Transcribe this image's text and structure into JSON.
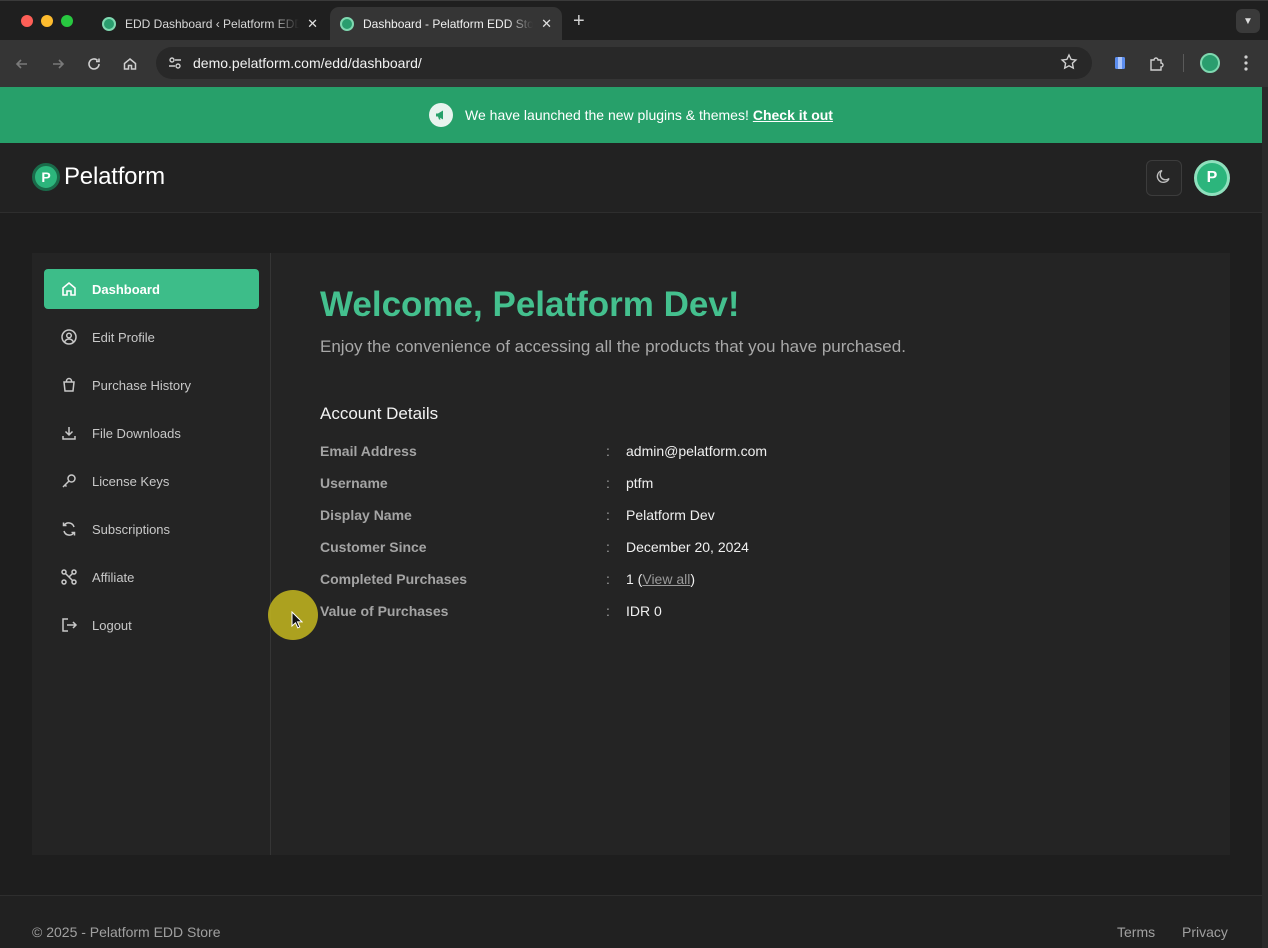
{
  "browser": {
    "tabs": [
      {
        "title": "EDD Dashboard ‹ Pelatform EDD Store",
        "active": false
      },
      {
        "title": "Dashboard - Pelatform EDD Store",
        "active": true
      }
    ],
    "url": "demo.pelatform.com/edd/dashboard/",
    "icons": {
      "back": "arrow-left-icon",
      "forward": "arrow-right-icon",
      "reload": "reload-icon",
      "home": "home-icon",
      "site_info": "tune-icon",
      "bookmark": "star-icon",
      "extension_1": "bookmark-extension-icon",
      "extensions": "puzzle-icon",
      "profile": "profile-icon",
      "menu": "kebab-menu-icon",
      "new_tab": "plus-icon",
      "tab_close": "close-icon",
      "tab_search": "chevron-down-icon"
    }
  },
  "announcement": {
    "text": "We have launched the new plugins & themes!",
    "link": "Check it out",
    "icon": "megaphone-icon"
  },
  "header": {
    "logo_text": "Pelatform",
    "theme_toggle_icon": "moon-icon"
  },
  "sidebar": {
    "items": [
      {
        "label": "Dashboard",
        "icon": "home-icon",
        "active": true
      },
      {
        "label": "Edit Profile",
        "icon": "user-circle-icon",
        "active": false
      },
      {
        "label": "Purchase History",
        "icon": "shopping-bag-icon",
        "active": false
      },
      {
        "label": "File Downloads",
        "icon": "download-icon",
        "active": false
      },
      {
        "label": "License Keys",
        "icon": "key-icon",
        "active": false
      },
      {
        "label": "Subscriptions",
        "icon": "refresh-icon",
        "active": false
      },
      {
        "label": "Affiliate",
        "icon": "share-nodes-icon",
        "active": false
      },
      {
        "label": "Logout",
        "icon": "logout-icon",
        "active": false
      }
    ]
  },
  "main": {
    "welcome": "Welcome, Pelatform Dev!",
    "subtitle": "Enjoy the convenience of accessing all the products that you have purchased.",
    "account_title": "Account Details",
    "rows": [
      {
        "label": "Email Address",
        "value": "admin@pelatform.com"
      },
      {
        "label": "Username",
        "value": "ptfm"
      },
      {
        "label": "Display Name",
        "value": "Pelatform Dev"
      },
      {
        "label": "Customer Since",
        "value": "December 20, 2024"
      },
      {
        "label": "Completed Purchases",
        "value": "1",
        "link": "View all"
      },
      {
        "label": "Value of Purchases",
        "value": "IDR 0"
      }
    ],
    "separator": ":"
  },
  "footer": {
    "copyright": "© 2025 - Pelatform EDD Store",
    "links": [
      "Terms",
      "Privacy"
    ]
  },
  "colors": {
    "brand_green": "#27a06a",
    "active_item": "#3dbd89",
    "welcome_text": "#44c08e",
    "background": "#1e1e1e"
  }
}
